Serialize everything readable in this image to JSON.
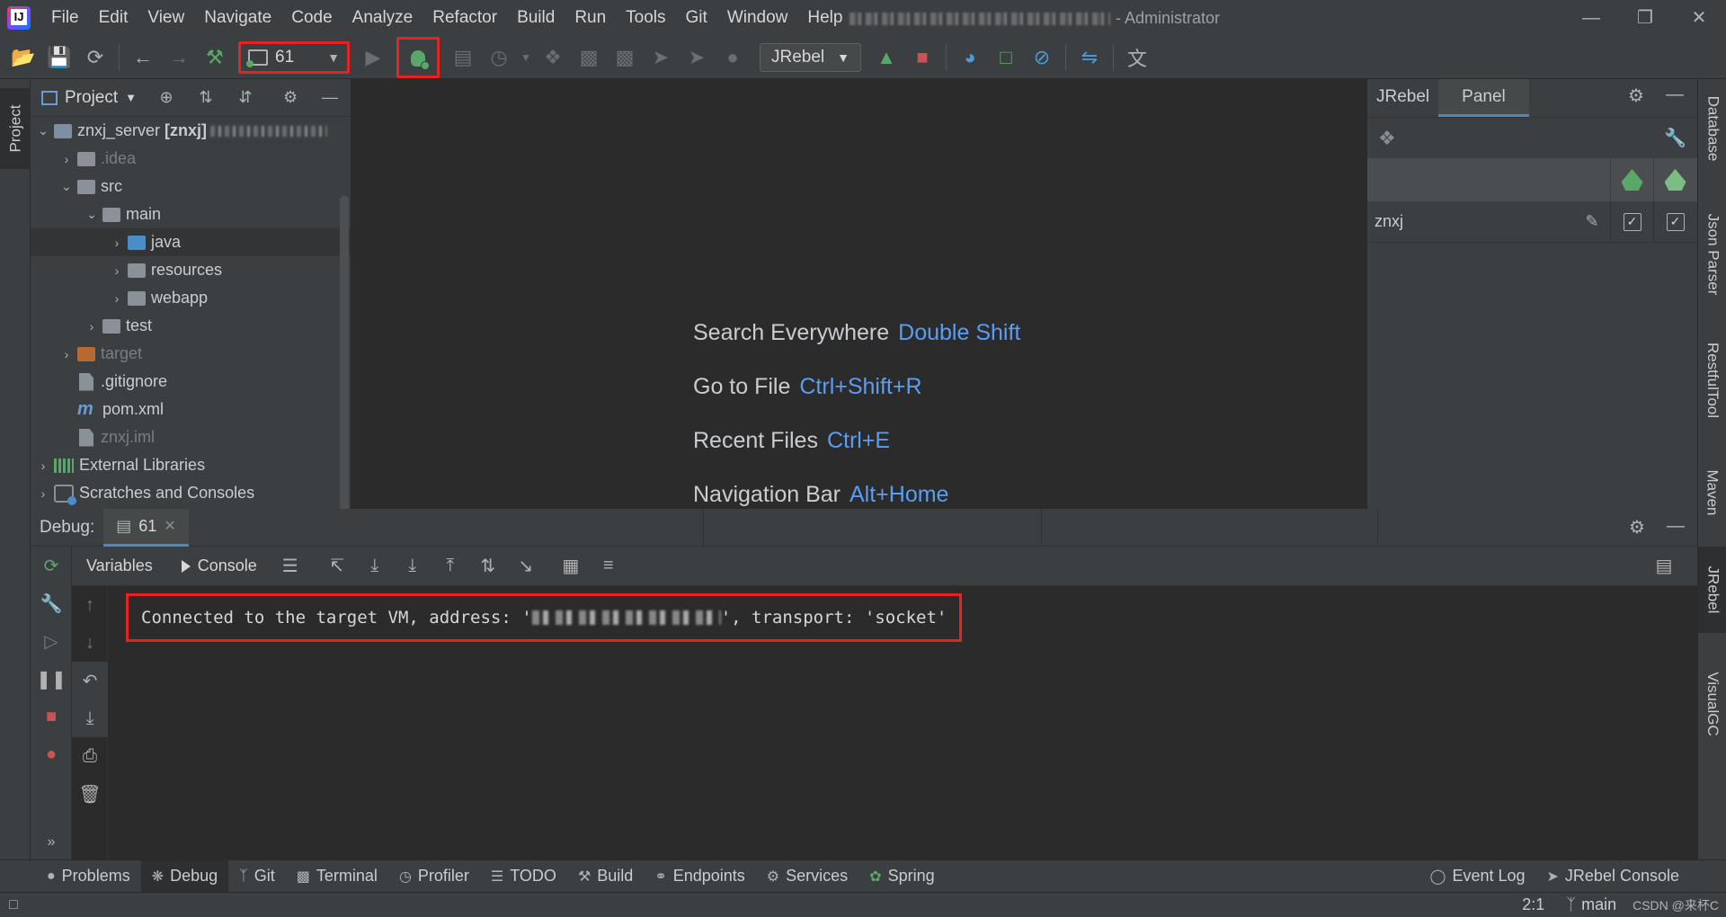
{
  "menu": {
    "items": [
      "File",
      "Edit",
      "View",
      "Navigate",
      "Code",
      "Analyze",
      "Refactor",
      "Build",
      "Run",
      "Tools",
      "Git",
      "Window",
      "Help"
    ],
    "window_title_suffix": "- Administrator"
  },
  "toolbar": {
    "run_config": "61",
    "jrebel_combo": "JRebel"
  },
  "left_stripe": {
    "project_tab": "Project"
  },
  "project": {
    "header": "Project",
    "tree": [
      {
        "label": "znxj_server",
        "suffix": "[znxj]"
      },
      {
        "label": ".idea"
      },
      {
        "label": "src"
      },
      {
        "label": "main"
      },
      {
        "label": "java"
      },
      {
        "label": "resources"
      },
      {
        "label": "webapp"
      },
      {
        "label": "test"
      },
      {
        "label": "target"
      },
      {
        "label": ".gitignore"
      },
      {
        "label": "pom.xml"
      },
      {
        "label": "znxj.iml"
      },
      {
        "label": "External Libraries"
      },
      {
        "label": "Scratches and Consoles"
      }
    ]
  },
  "editor": {
    "hints": [
      {
        "label": "Search Everywhere",
        "key": "Double Shift"
      },
      {
        "label": "Go to File",
        "key": "Ctrl+Shift+R"
      },
      {
        "label": "Recent Files",
        "key": "Ctrl+E"
      },
      {
        "label": "Navigation Bar",
        "key": "Alt+Home"
      }
    ]
  },
  "jrebel_panel": {
    "tabs": [
      "JRebel",
      "Panel"
    ],
    "row_module": "znxj"
  },
  "right_stripe": {
    "tabs": [
      "Database",
      "Json Parser",
      "RestfulTool",
      "Maven",
      "JRebel",
      "VisualGC"
    ]
  },
  "debug": {
    "label": "Debug:",
    "session_tab": "61",
    "subtabs": [
      "Variables",
      "Console"
    ],
    "console_prefix": "Connected to the target VM, address: '",
    "console_suffix": "', transport: 'socket'"
  },
  "bottom_tabs": [
    "Problems",
    "Debug",
    "Git",
    "Terminal",
    "Profiler",
    "TODO",
    "Build",
    "Endpoints",
    "Services",
    "Spring"
  ],
  "bottom_right_tabs": [
    "Event Log",
    "JRebel Console"
  ],
  "status": {
    "position": "2:1",
    "branch": "main",
    "watermark": "CSDN @来杯C"
  },
  "colors": {
    "accent": "#4a88c7",
    "highlight_box": "#e52323",
    "key_blue": "#589df6",
    "run_green": "#59a869"
  }
}
